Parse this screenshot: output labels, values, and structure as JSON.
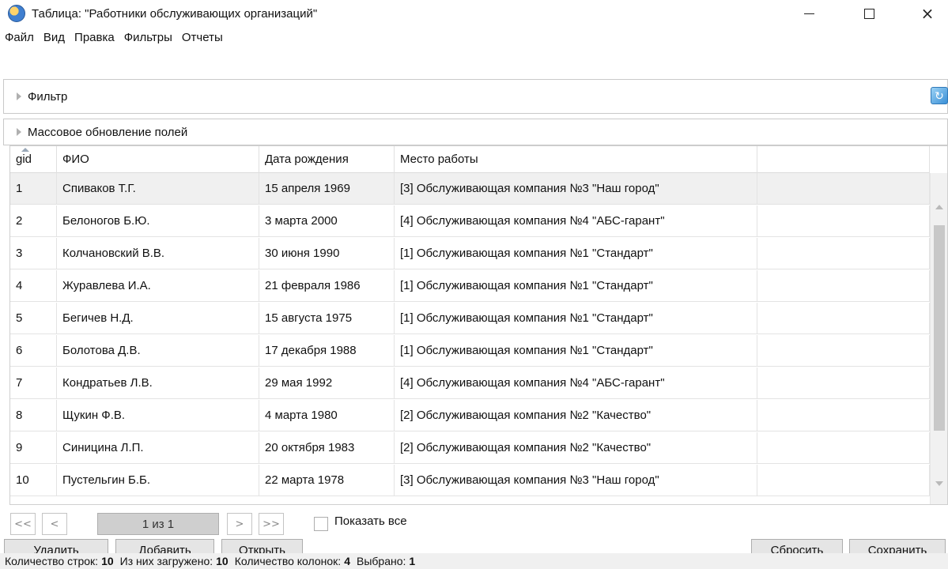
{
  "window": {
    "title": "Таблица: \"Работники обслуживающих организаций\"",
    "minimize_label": "",
    "close_glyph": "×"
  },
  "menu": [
    "Файл",
    "Вид",
    "Правка",
    "Фильтры",
    "Отчеты"
  ],
  "filter_panel": {
    "label": "Фильтр",
    "refresh_icon": "↻"
  },
  "mass_update_panel": {
    "label": "Массовое обновление полей"
  },
  "table": {
    "columns": [
      "gid",
      "ФИО",
      "Дата рождения",
      "Место работы",
      ""
    ],
    "rows": [
      [
        "1",
        "Спиваков Т.Г.",
        "15 апреля 1969",
        "[3]  Обслуживающая компания №3 \"Наш город\""
      ],
      [
        "2",
        "Белоногов Б.Ю.",
        "3 марта 2000",
        "[4]  Обслуживающая компания №4 \"АБС-гарант\""
      ],
      [
        "3",
        "Колчановский В.В.",
        "30 июня 1990",
        "[1]  Обслуживающая компания №1 \"Стандарт\""
      ],
      [
        "4",
        "Журавлева И.А.",
        "21 февраля 1986",
        "[1]  Обслуживающая компания №1 \"Стандарт\""
      ],
      [
        "5",
        "Бегичев Н.Д.",
        "15 августа 1975",
        "[1]  Обслуживающая компания №1 \"Стандарт\""
      ],
      [
        "6",
        "Болотова Д.В.",
        "17 декабря 1988",
        "[1]  Обслуживающая компания №1 \"Стандарт\""
      ],
      [
        "7",
        "Кондратьев Л.В.",
        "29 мая 1992",
        "[4]  Обслуживающая компания №4 \"АБС-гарант\""
      ],
      [
        "8",
        "Щукин Ф.В.",
        "4 марта 1980",
        "[2]  Обслуживающая компания №2 \"Качество\""
      ],
      [
        "9",
        "Синицина Л.П.",
        "20 октября 1983",
        "[2]  Обслуживающая компания №2 \"Качество\""
      ],
      [
        "10",
        "Пустельгин Б.Б.",
        "22 марта 1978",
        "[3]  Обслуживающая компания №3 \"Наш город\""
      ]
    ],
    "selected_row": 0
  },
  "pager": {
    "first": "<<",
    "prev": "<",
    "page_info": "1 из 1",
    "next": ">",
    "last": ">>",
    "show_all_label": "Показать все",
    "show_all_checked": false
  },
  "actions": {
    "delete": "Удалить",
    "add": "Добавить",
    "open": "Открыть",
    "reset": "Сбросить",
    "save": "Сохранить"
  },
  "status": {
    "rows_label": "Количество строк:",
    "rows_value": "10",
    "loaded_label": "Из них загружено:",
    "loaded_value": "10",
    "columns_label": "Количество колонок:",
    "columns_value": "4",
    "selected_label": "Выбрано:",
    "selected_value": "1"
  },
  "colors": {
    "selected_row": "#f0f0f0",
    "status_bar": "#f0f0f0",
    "button_face": "#e5e5e5"
  }
}
